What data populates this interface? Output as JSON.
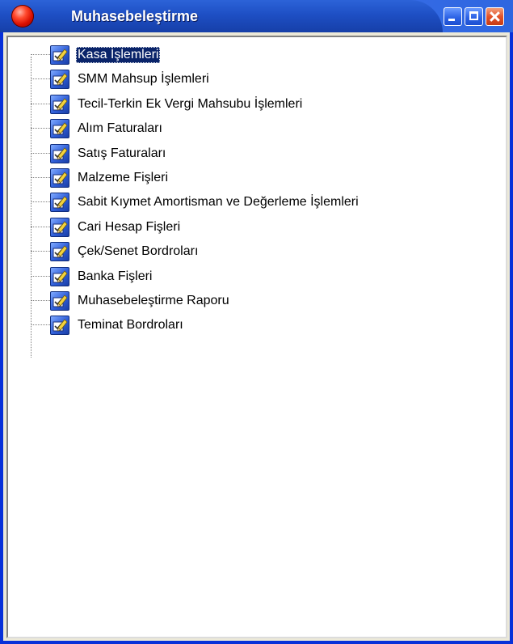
{
  "window": {
    "title": "Muhasebeleştirme"
  },
  "titlebar_buttons": {
    "minimize": "minimize",
    "maximize": "maximize",
    "close": "close"
  },
  "tree": {
    "selected_index": 0,
    "items": [
      {
        "label": "Kasa İşlemleri",
        "icon": "pencil-checkbox-icon"
      },
      {
        "label": "SMM Mahsup İşlemleri",
        "icon": "pencil-checkbox-icon"
      },
      {
        "label": "Tecil-Terkin Ek Vergi Mahsubu İşlemleri",
        "icon": "pencil-checkbox-icon"
      },
      {
        "label": "Alım Faturaları",
        "icon": "pencil-checkbox-icon"
      },
      {
        "label": "Satış Faturaları",
        "icon": "pencil-checkbox-icon"
      },
      {
        "label": "Malzeme Fişleri",
        "icon": "pencil-checkbox-icon"
      },
      {
        "label": "Sabit Kıymet Amortisman ve Değerleme İşlemleri",
        "icon": "pencil-checkbox-icon"
      },
      {
        "label": "Cari Hesap Fişleri",
        "icon": "pencil-checkbox-icon"
      },
      {
        "label": "Çek/Senet Bordroları",
        "icon": "pencil-checkbox-icon"
      },
      {
        "label": "Banka Fişleri",
        "icon": "pencil-checkbox-icon"
      },
      {
        "label": "Muhasebeleştirme Raporu",
        "icon": "pencil-checkbox-icon"
      },
      {
        "label": "Teminat Bordroları",
        "icon": "pencil-checkbox-icon"
      }
    ]
  },
  "colors": {
    "titlebar": "#2c63d8",
    "selection": "#0a246a",
    "close_button": "#e2522a"
  }
}
